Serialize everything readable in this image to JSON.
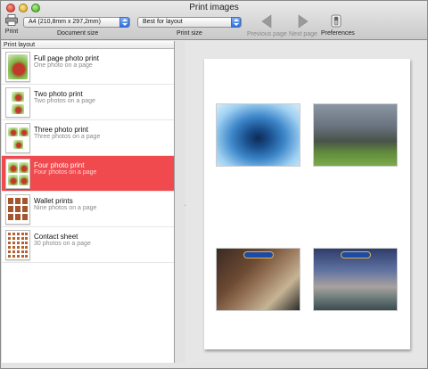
{
  "window": {
    "title": "Print images"
  },
  "toolbar": {
    "print_label": "Print",
    "document_size": {
      "value": "A4 (210,8mm x 297,2mm)",
      "caption": "Document size"
    },
    "print_size": {
      "value": "Best for layout",
      "caption": "Print size"
    },
    "previous_page_label": "Previous page",
    "next_page_label": "Next page",
    "preferences_label": "Preferences"
  },
  "sidebar": {
    "header": "Print layout",
    "items": [
      {
        "title": "Full page photo print",
        "subtitle": "One photo on a page",
        "layout": "1x1"
      },
      {
        "title": "Two photo print",
        "subtitle": "Two photos on a page",
        "layout": "1x2"
      },
      {
        "title": "Three photo print",
        "subtitle": "Three photos on a page",
        "layout": "3"
      },
      {
        "title": "Four photo print",
        "subtitle": "Four photos on a page",
        "layout": "2x2",
        "selected": true
      },
      {
        "title": "Wallet prints",
        "subtitle": "Nine photos on a page",
        "layout": "3x3"
      },
      {
        "title": "Contact sheet",
        "subtitle": "30 photos on a page",
        "layout": "5x6"
      }
    ]
  },
  "preview": {
    "photos": [
      "water-drop",
      "yosemite-valley",
      "ratatouille-poster",
      "ratatouille-paris-poster"
    ]
  },
  "colors": {
    "selection": "#f04a4f",
    "accent": "#2f6fe0"
  }
}
